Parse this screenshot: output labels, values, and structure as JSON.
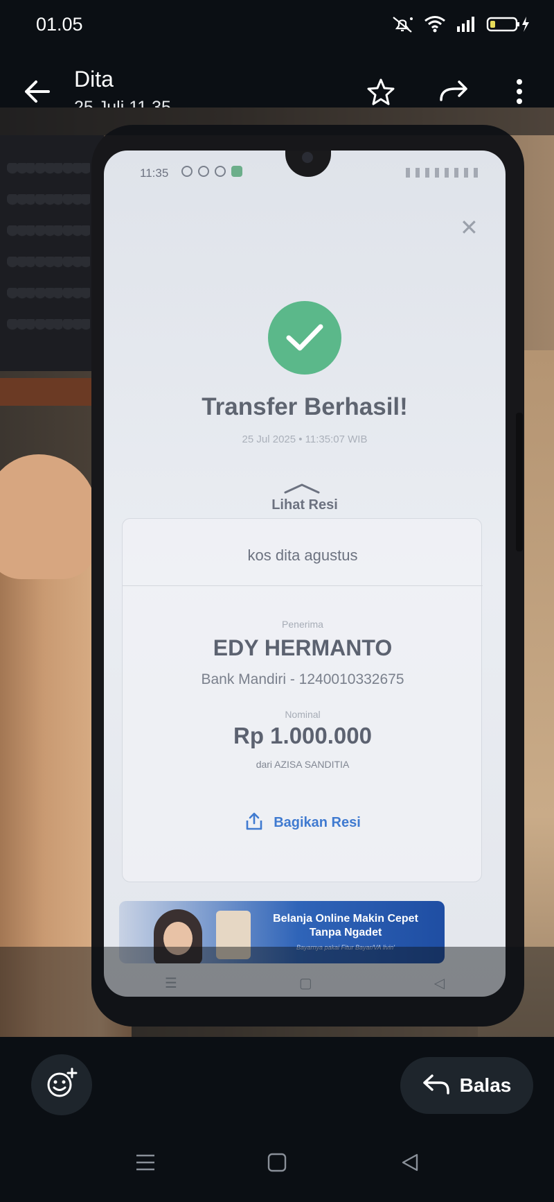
{
  "status_bar": {
    "time": "01.05",
    "icons": [
      "mute-icon",
      "wifi-icon",
      "signal-icon",
      "battery-charging-icon"
    ]
  },
  "header": {
    "sender": "Dita",
    "timestamp": "25 Juli 11.35",
    "icons": [
      "back-arrow-icon",
      "star-icon",
      "forward-icon",
      "more-vert-icon"
    ]
  },
  "photo": {
    "inner_status_time": "11:35",
    "receipt": {
      "title": "Transfer Berhasil!",
      "datetime": "25 Jul 2025 • 11:35:07 WIB",
      "view_receipt": "Lihat Resi",
      "note": "kos dita agustus",
      "recipient_label": "Penerima",
      "recipient_name": "EDY HERMANTO",
      "recipient_bank": "Bank Mandiri - 1240010332675",
      "amount_label": "Nominal",
      "amount": "Rp 1.000.000",
      "sender": "dari AZISA SANDITIA",
      "share_label": "Bagikan Resi"
    },
    "banner": {
      "title": "Belanja Online Makin Cepet Tanpa Ngadet",
      "subtitle": "Bayarnya pakai Fitur Bayar/VA livin'"
    }
  },
  "footer": {
    "reply_label": "Balas",
    "icons": [
      "add-emoji-icon",
      "reply-icon"
    ]
  },
  "colors": {
    "background": "#0b0f14",
    "success_green": "#5bb88a",
    "link_blue": "#3f7ad0",
    "button_bg": "#1e252c"
  }
}
